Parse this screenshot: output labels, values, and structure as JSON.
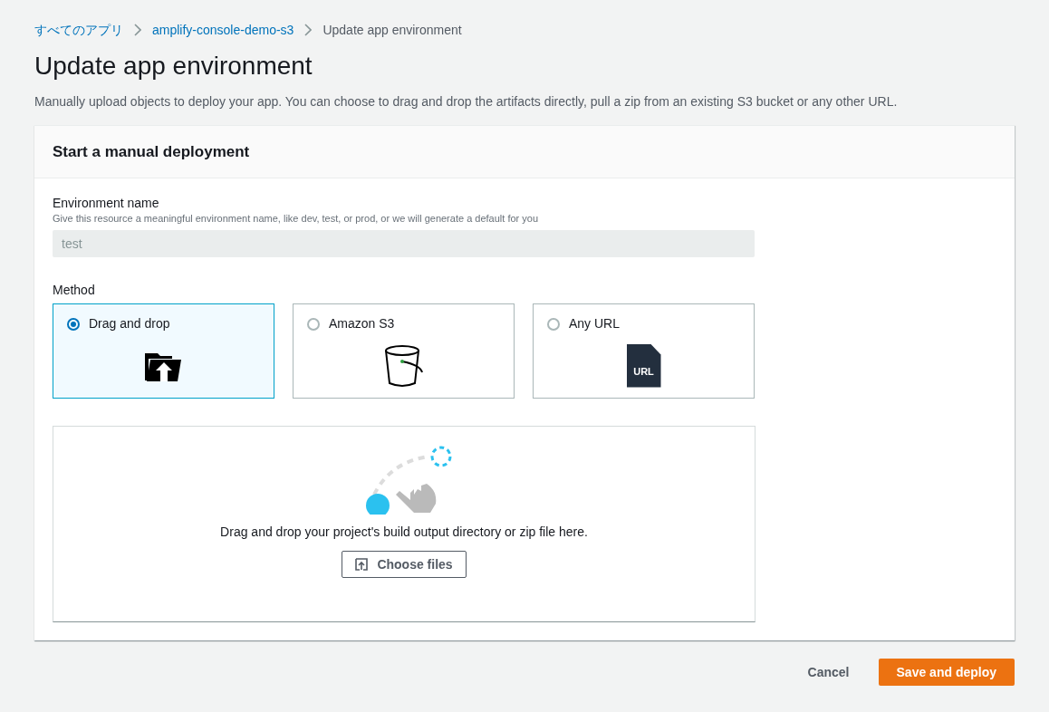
{
  "breadcrumbs": [
    {
      "label": "すべてのアプリ",
      "link": true
    },
    {
      "label": "amplify-console-demo-s3",
      "link": true
    },
    {
      "label": "Update app environment",
      "link": false
    }
  ],
  "title": "Update app environment",
  "description": "Manually upload objects to deploy your app. You can choose to drag and drop the artifacts directly, pull a zip from an existing S3 bucket or any other URL.",
  "panel": {
    "title": "Start a manual deployment",
    "environment_name": {
      "label": "Environment name",
      "hint": "Give this resource a meaningful environment name, like dev, test, or prod, or we will generate a default for you",
      "value": "test",
      "disabled": true
    },
    "method": {
      "label": "Method",
      "options": [
        {
          "label": "Drag and drop",
          "kind": "folder",
          "selected": true
        },
        {
          "label": "Amazon S3",
          "kind": "bucket",
          "selected": false
        },
        {
          "label": "Any URL",
          "kind": "url",
          "icon_label": "URL",
          "selected": false
        }
      ]
    },
    "dropzone": {
      "text": "Drag and drop your project's build output directory or zip file here.",
      "button": "Choose files"
    }
  },
  "actions": [
    {
      "label": "Cancel",
      "kind": "link"
    },
    {
      "label": "Save and deploy",
      "kind": "primary"
    }
  ]
}
